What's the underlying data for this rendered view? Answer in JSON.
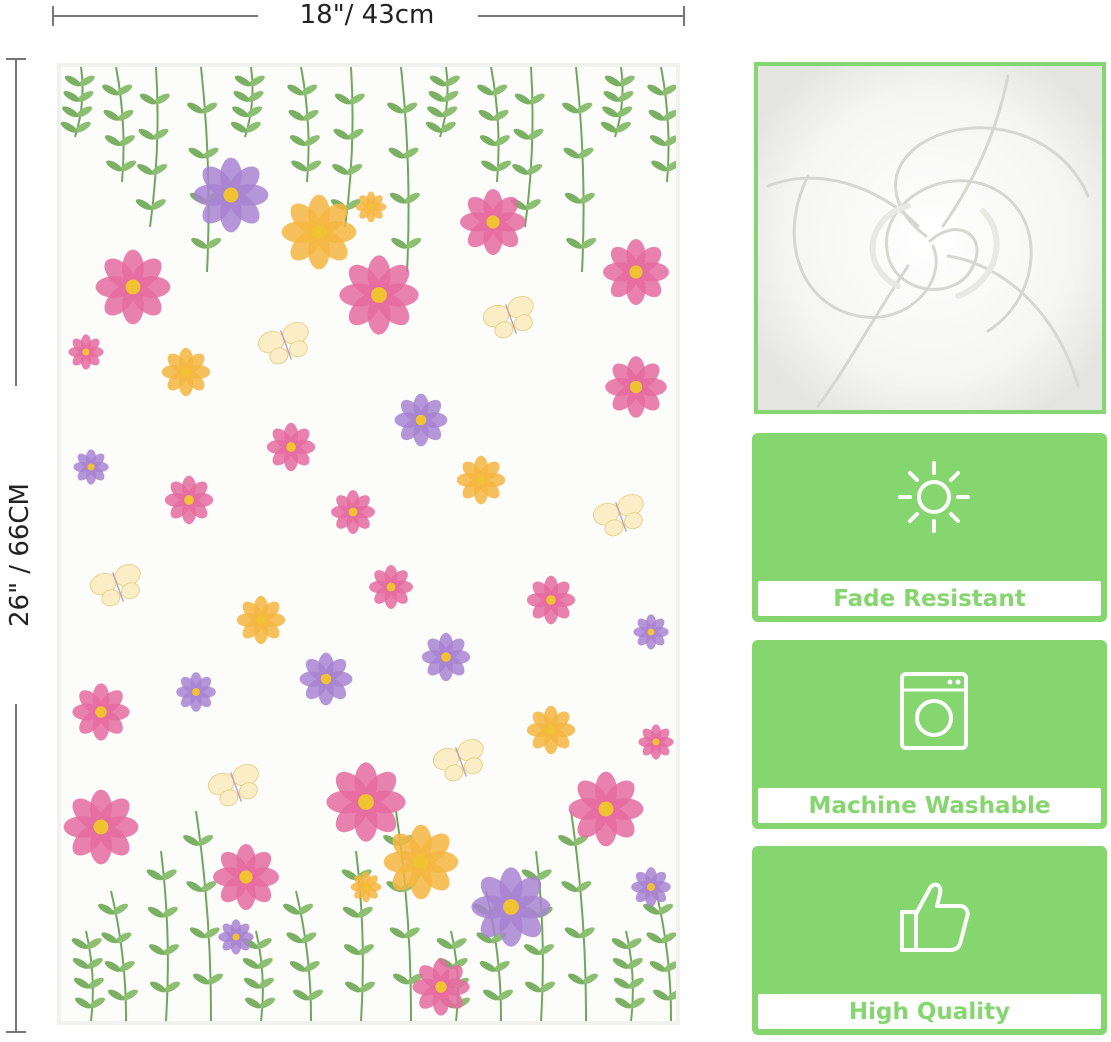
{
  "dimensions": {
    "width_label": "18\"/ 43cm",
    "height_label": "26\" / 66CM"
  },
  "features": [
    {
      "label": "Fade Resistant",
      "icon": "sun-icon"
    },
    {
      "label": "Machine Washable",
      "icon": "washing-machine-icon"
    },
    {
      "label": "High Quality",
      "icon": "thumbs-up-icon"
    }
  ],
  "colors": {
    "accent_green": "#86d66f",
    "towel_white": "#fcfcfa",
    "flower_pink": "#e56ba1",
    "flower_yellow": "#f4b63f",
    "flower_purple": "#a884d1",
    "leaf_green": "#6ea85a"
  }
}
